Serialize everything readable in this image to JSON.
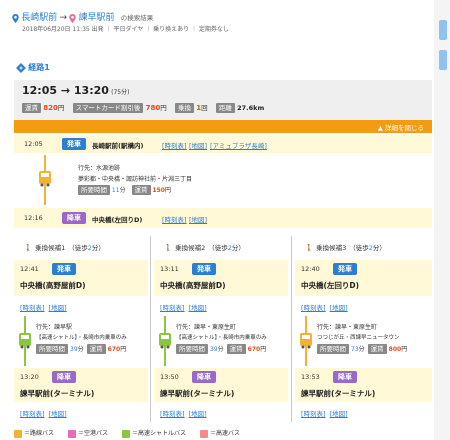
{
  "header": {
    "from": "長崎駅前",
    "arrow": "→",
    "to": "諫早駅前",
    "suffix": "の検索結果",
    "meta": "2018年06月20日 11:35 出発 ｜ 平日ダイヤ ｜ 乗り換えあり ｜ 定期券なし"
  },
  "route": {
    "label": "経路1",
    "time_range": "12:05 → 13:20",
    "duration": "(75分)",
    "fare_label": "運賃",
    "fare": "820",
    "yen": "円",
    "smartcard_label": "スマートカード割引後",
    "smartcard_fare": "780",
    "transfer_label": "乗換",
    "transfers": "1",
    "transfers_unit": "回",
    "distance_label": "距離",
    "distance": "27.6km",
    "close_details": "▲ 詳細を閉じる"
  },
  "leg1": {
    "dep_time": "12:05",
    "dep_badge": "発車",
    "dep_stop": "長崎駅前(駅構内)",
    "links": [
      "[時刻表]",
      "[地図]",
      "[アミュプラザ長崎]"
    ],
    "dest_prefix": "行先：",
    "dest": "水源池跡",
    "via": "夢彩都・中央橋・諏訪神社前・片淵三丁目",
    "time_label": "所要時間",
    "time_val": "11",
    "time_unit": "分",
    "fare_label": "運賃",
    "fare": "150",
    "yen": "円",
    "arr_time": "12:16",
    "arr_badge": "降車",
    "arr_stop": "中央橋(左回りD)",
    "arr_links": [
      "[時刻表]",
      "[地図]"
    ]
  },
  "candidates": [
    {
      "label": "乗換候補1",
      "walk": "（徒歩",
      "walk_min": "2",
      "walk_unit": "分）",
      "dep_time": "12:41",
      "dep_badge": "発車",
      "dep_stop": "中央橋(高野屋前D)",
      "links": [
        "[時刻表]",
        "[地図]"
      ],
      "dest_prefix": "行先：",
      "dest": "諫早駅",
      "via": "【高速シャトル】・長崎市内乗車のみ",
      "time_label": "所要時間",
      "time_val": "39",
      "time_unit": "分",
      "fare_label": "運賃",
      "fare": "670",
      "yen": "円",
      "arr_time": "13:20",
      "arr_badge": "降車",
      "arr_stop": "諫早駅前(ターミナル)",
      "arr_links": [
        "[時刻表]",
        "[地図]"
      ]
    },
    {
      "label": "乗換候補2",
      "walk": "（徒歩",
      "walk_min": "2",
      "walk_unit": "分）",
      "dep_time": "13:11",
      "dep_badge": "発車",
      "dep_stop": "中央橋(高野屋前D)",
      "links": [
        "[時刻表]",
        "[地図]"
      ],
      "dest_prefix": "行先：",
      "dest": "諫早・東原生町",
      "via": "【高速シャトル】・長崎市内乗車のみ",
      "time_label": "所要時間",
      "time_val": "39",
      "time_unit": "分",
      "fare_label": "運賃",
      "fare": "670",
      "yen": "円",
      "arr_time": "13:50",
      "arr_badge": "降車",
      "arr_stop": "諫早駅前(ターミナル)",
      "arr_links": [
        "[時刻表]",
        "[地図]"
      ]
    },
    {
      "label": "乗換候補3",
      "walk": "（徒歩",
      "walk_min": "2",
      "walk_unit": "分）",
      "dep_time": "12:40",
      "dep_badge": "発車",
      "dep_stop": "中央橋(左回りD)",
      "links": [
        "[時刻表]",
        "[地図]"
      ],
      "dest_prefix": "行先：",
      "dest": "諫早・東原生町",
      "via": "つつじが丘・西諫早ニュータウン",
      "time_label": "所要時間",
      "time_val": "73",
      "time_unit": "分",
      "fare_label": "運賃",
      "fare": "800",
      "yen": "円",
      "arr_time": "13:53",
      "arr_badge": "降車",
      "arr_stop": "諫早駅前(ターミナル)",
      "arr_links": [
        "[時刻表]",
        "[地図]"
      ]
    }
  ],
  "legend": [
    {
      "label": "＝路線バス",
      "color": "#f2b233"
    },
    {
      "label": "＝空港バス",
      "color": "#e66bbf"
    },
    {
      "label": "＝高速シャトルバス",
      "color": "#8cc63f"
    },
    {
      "label": "＝高速バス",
      "color": "#f08c8c"
    }
  ],
  "colors": {
    "accent_blue": "#2a7fd4",
    "orange_bar": "#f39c12",
    "fare_red": "#e64a19",
    "arrive_purple": "#9a68c8",
    "section_yellow": "#fff9d8"
  }
}
